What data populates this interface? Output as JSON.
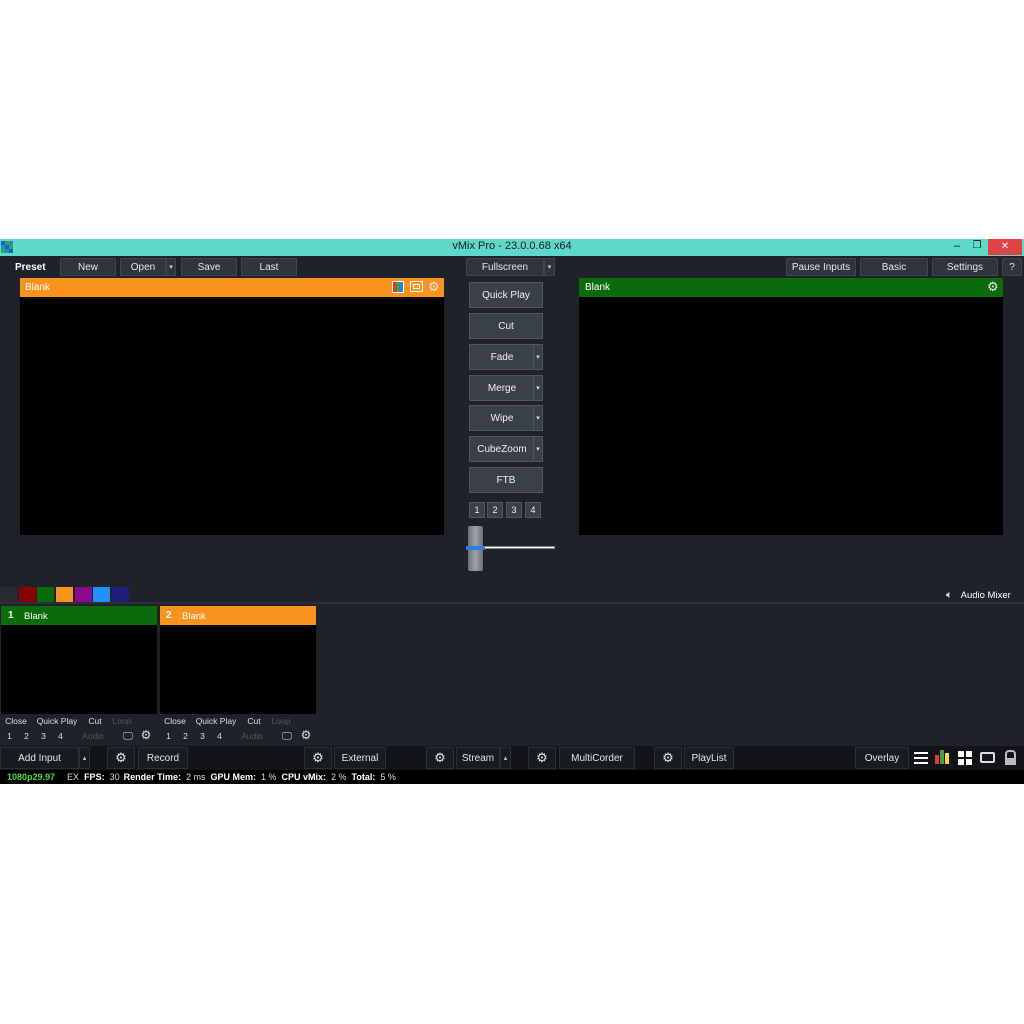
{
  "window": {
    "title": "vMix Pro - 23.0.0.68 x64",
    "minimize_glyph": "–",
    "restore_glyph": "❐",
    "close_glyph": "✕",
    "titlebar_color": "#5fd8c8"
  },
  "toolbar": {
    "preset_label": "Preset",
    "new_label": "New",
    "open_label": "Open",
    "save_label": "Save",
    "last_label": "Last",
    "fullscreen_label": "Fullscreen",
    "pause_inputs_label": "Pause Inputs",
    "basic_label": "Basic",
    "settings_label": "Settings",
    "help_label": "?"
  },
  "preview": {
    "title": "Blank",
    "color": "#f7931e"
  },
  "output": {
    "title": "Blank",
    "color": "#0b6b0b"
  },
  "transitions": {
    "quick_play": "Quick Play",
    "cut": "Cut",
    "fade": "Fade",
    "merge": "Merge",
    "wipe": "Wipe",
    "cubezoom": "CubeZoom",
    "ftb": "FTB",
    "numbers": [
      "1",
      "2",
      "3",
      "4"
    ],
    "t_bar_position": 0.0
  },
  "color_tags": [
    "#272a30",
    "#8b0000",
    "#0b6b0b",
    "#f7931e",
    "#8b0a8b",
    "#1e90ff",
    "#1f1f7a"
  ],
  "audio_mixer": {
    "label": "Audio Mixer",
    "icon": "speaker-icon"
  },
  "inputs": [
    {
      "number": "1",
      "title": "Blank",
      "color": "#0b6b0b",
      "controls": [
        "Close",
        "Quick Play",
        "Cut",
        "Loop"
      ],
      "numbers": [
        "1",
        "2",
        "3",
        "4"
      ],
      "audio_label": "Audio"
    },
    {
      "number": "2",
      "title": "Blank",
      "color": "#f7931e",
      "controls": [
        "Close",
        "Quick Play",
        "Cut",
        "Loop"
      ],
      "numbers": [
        "1",
        "2",
        "3",
        "4"
      ],
      "audio_label": "Audio"
    }
  ],
  "bottom": {
    "add_input": "Add Input",
    "record": "Record",
    "external": "External",
    "stream": "Stream",
    "multicorder": "MultiCorder",
    "playlist": "PlayList",
    "overlay": "Overlay"
  },
  "status": {
    "format": "1080p29.97",
    "ex": "EX",
    "fps_label": "FPS:",
    "fps_value": "30",
    "render_label": "Render Time:",
    "render_value": "2 ms",
    "gpu_label": "GPU Mem:",
    "gpu_value": "1 %",
    "cpu_label": "CPU vMix:",
    "cpu_value": "2 %",
    "total_label": "Total:",
    "total_value": "5 %",
    "format_color": "#4ddc3c"
  }
}
